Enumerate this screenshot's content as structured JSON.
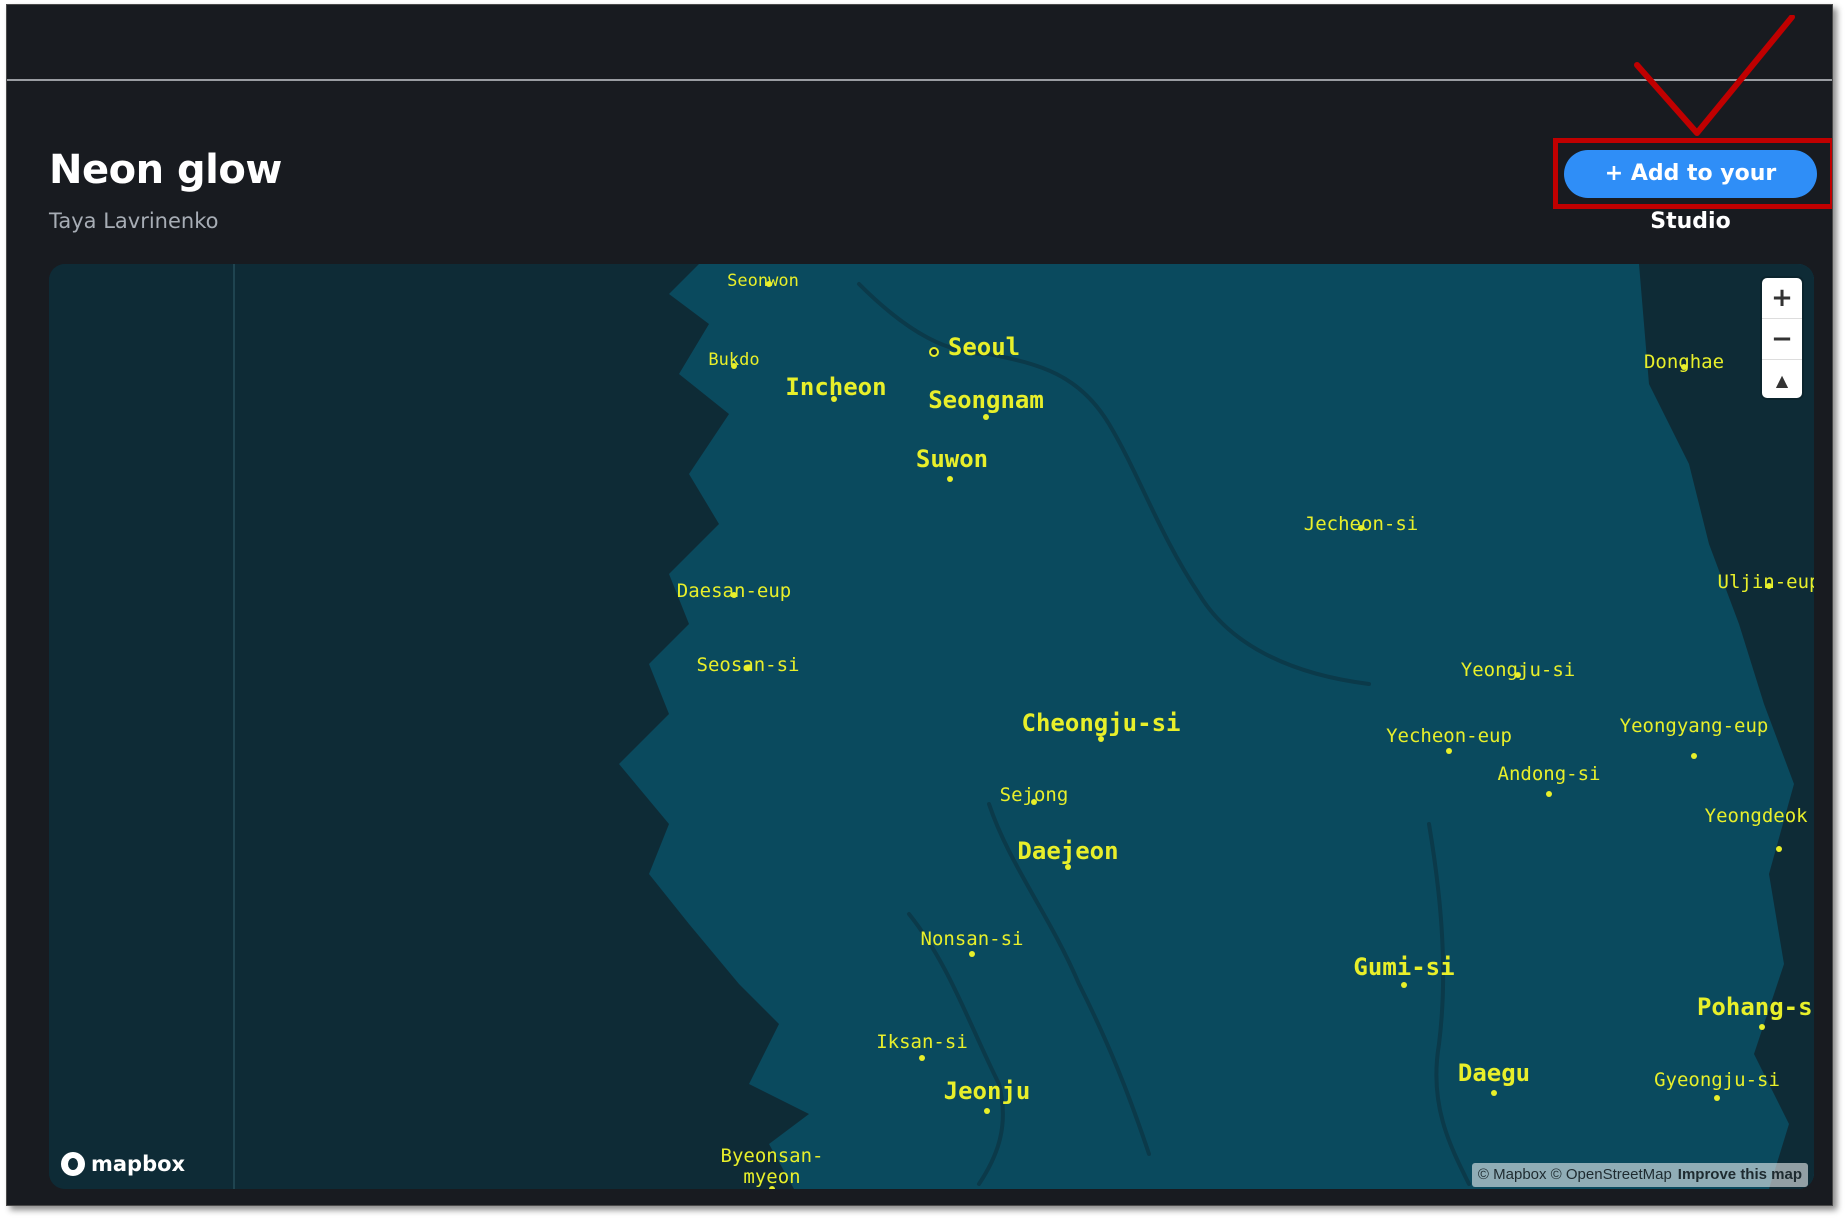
{
  "style": {
    "title": "Neon glow",
    "author": "Taya Lavrinenko",
    "add_button_label": "+ Add to your Studio"
  },
  "colors": {
    "label": "#e8ef2a",
    "land": "#0a4a5e",
    "sea": "#0e2b36",
    "button": "#2f8ef7",
    "annotation": "#c00000"
  },
  "map": {
    "zoom_in_label": "+",
    "zoom_out_label": "−",
    "compass_label": "▲",
    "logo_text": "mapbox",
    "attribution": "© Mapbox © OpenStreetMap",
    "improve_label": "Improve this map",
    "cities": [
      {
        "name": "Seonwon",
        "size": "sm"
      },
      {
        "name": "Seoul",
        "size": "big",
        "capital": true
      },
      {
        "name": "Bukdo",
        "size": "sm"
      },
      {
        "name": "Incheon",
        "size": "big"
      },
      {
        "name": "Seongnam",
        "size": "big"
      },
      {
        "name": "Suwon",
        "size": "big"
      },
      {
        "name": "Donghae",
        "size": "med"
      },
      {
        "name": "Jecheon-si",
        "size": "med"
      },
      {
        "name": "Uljin-eup",
        "size": "med"
      },
      {
        "name": "Daesan-eup",
        "size": "med"
      },
      {
        "name": "Seosan-si",
        "size": "med"
      },
      {
        "name": "Yeongju-si",
        "size": "med"
      },
      {
        "name": "Cheongju-si",
        "size": "big"
      },
      {
        "name": "Yecheon-eup",
        "size": "med"
      },
      {
        "name": "Yeongyang-eup",
        "size": "med"
      },
      {
        "name": "Andong-si",
        "size": "med"
      },
      {
        "name": "Sejong",
        "size": "med"
      },
      {
        "name": "Yeongdeok eup",
        "size": "med"
      },
      {
        "name": "Daejeon",
        "size": "big"
      },
      {
        "name": "Nonsan-si",
        "size": "med"
      },
      {
        "name": "Gumi-si",
        "size": "big"
      },
      {
        "name": "Pohang-si",
        "size": "big"
      },
      {
        "name": "Iksan-si",
        "size": "med"
      },
      {
        "name": "Daegu",
        "size": "big"
      },
      {
        "name": "Gyeongju-si",
        "size": "med"
      },
      {
        "name": "Jeonju",
        "size": "big"
      },
      {
        "name": "Byeonsan-myeon",
        "size": "med"
      }
    ]
  }
}
